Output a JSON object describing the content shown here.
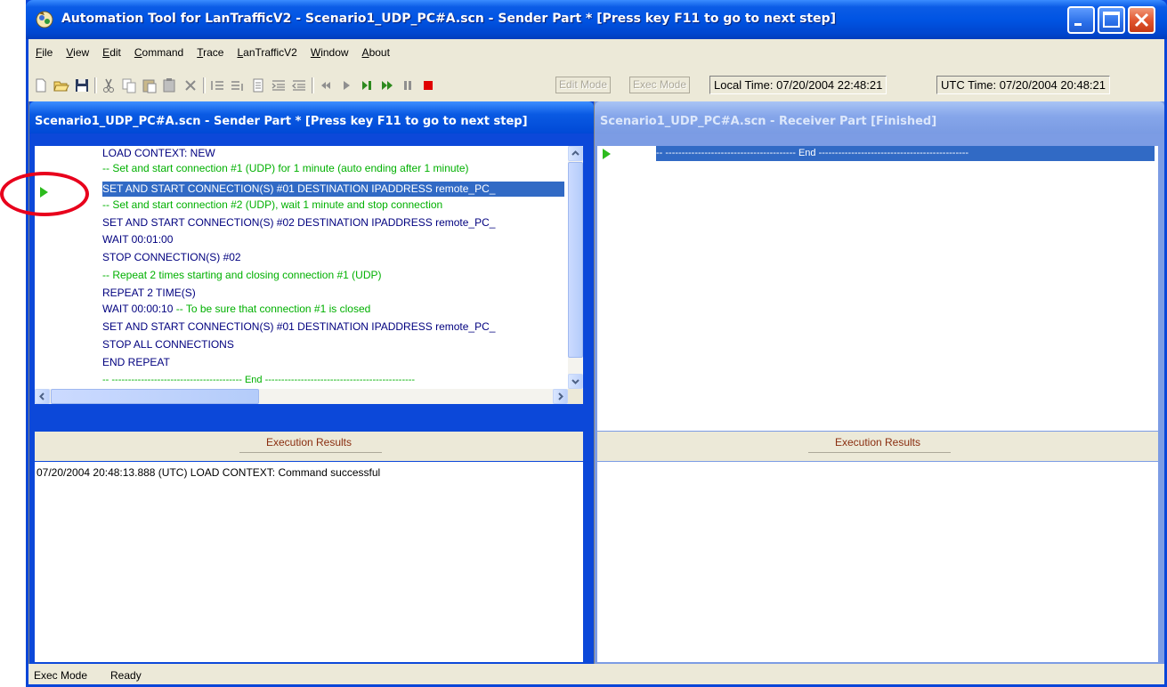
{
  "window": {
    "title": "Automation Tool for LanTrafficV2 - Scenario1_UDP_PC#A.scn - Sender Part * [Press key F11 to go to next step]"
  },
  "menubar": {
    "items": [
      {
        "u": "F",
        "rest": "ile"
      },
      {
        "u": "V",
        "rest": "iew"
      },
      {
        "u": "E",
        "rest": "dit"
      },
      {
        "u": "C",
        "rest": "ommand"
      },
      {
        "u": "T",
        "rest": "race"
      },
      {
        "u": "L",
        "rest": "anTrafficV2"
      },
      {
        "u": "W",
        "rest": "indow"
      },
      {
        "u": "A",
        "rest": "bout"
      }
    ]
  },
  "toolbar": {
    "edit_mode_label": "Edit Mode",
    "exec_mode_label": "Exec Mode",
    "local_time": "Local Time: 07/20/2004 22:48:21",
    "utc_time": "UTC Time: 07/20/2004 20:48:21",
    "icons": [
      "new-icon",
      "open-icon",
      "save-icon",
      "cut-icon",
      "copy-icon",
      "paste-icon",
      "paste-special-icon",
      "delete-icon",
      "insert-line-icon",
      "remove-line-icon",
      "document-icon",
      "indent-icon",
      "outdent-icon",
      "rewind-icon",
      "play-icon",
      "step-icon",
      "fast-forward-icon",
      "pause-icon",
      "stop-icon"
    ],
    "colors": {
      "play": "#2d8a1e",
      "stop": "#e00000"
    }
  },
  "sender": {
    "title": "Scenario1_UDP_PC#A.scn - Sender Part * [Press key F11 to go to next step]",
    "lines": [
      {
        "kind": "kw",
        "text": "LOAD CONTEXT: NEW"
      },
      {
        "kind": "cm",
        "text": "-- Set and start connection #1 (UDP) for 1 minute (auto ending after 1 minute)"
      },
      {
        "kind": "sel",
        "text": "SET AND START CONNECTION(S) #01  DESTINATION IPADDRESS remote_PC_"
      },
      {
        "kind": "cm",
        "text": "-- Set and start connection #2 (UDP), wait 1 minute and stop connection"
      },
      {
        "kind": "kw",
        "text": "SET AND START CONNECTION(S) #02  DESTINATION IPADDRESS remote_PC_"
      },
      {
        "kind": "kw",
        "text": "WAIT 00:01:00"
      },
      {
        "kind": "kw",
        "text": "STOP CONNECTION(S) #02"
      },
      {
        "kind": "cm",
        "text": "-- Repeat 2 times starting and closing connection #1 (UDP)"
      },
      {
        "kind": "kw",
        "text": "REPEAT 2 TIME(S)"
      },
      {
        "kind": "mix",
        "text": "WAIT 00:00:10",
        "comment": "  -- To be sure that connection #1 is closed"
      },
      {
        "kind": "kw",
        "text": "SET AND START CONNECTION(S) #01  DESTINATION IPADDRESS remote_PC_"
      },
      {
        "kind": "kw",
        "text": "STOP ALL CONNECTIONS"
      },
      {
        "kind": "kw",
        "text": "END REPEAT"
      },
      {
        "kind": "cm",
        "text": "-- ---------------------------------------- End ----------------------------------------------"
      }
    ],
    "results_label": "Execution Results",
    "results": [
      "07/20/2004 20:48:13.888 (UTC)    LOAD CONTEXT: Command successful"
    ]
  },
  "receiver": {
    "title": "Scenario1_UDP_PC#A.scn - Receiver Part [Finished]",
    "end_line": "-- ---------------------------------------- End ----------------------------------------------",
    "results_label": "Execution Results"
  },
  "status": {
    "mode": "Exec Mode",
    "state": "Ready"
  }
}
